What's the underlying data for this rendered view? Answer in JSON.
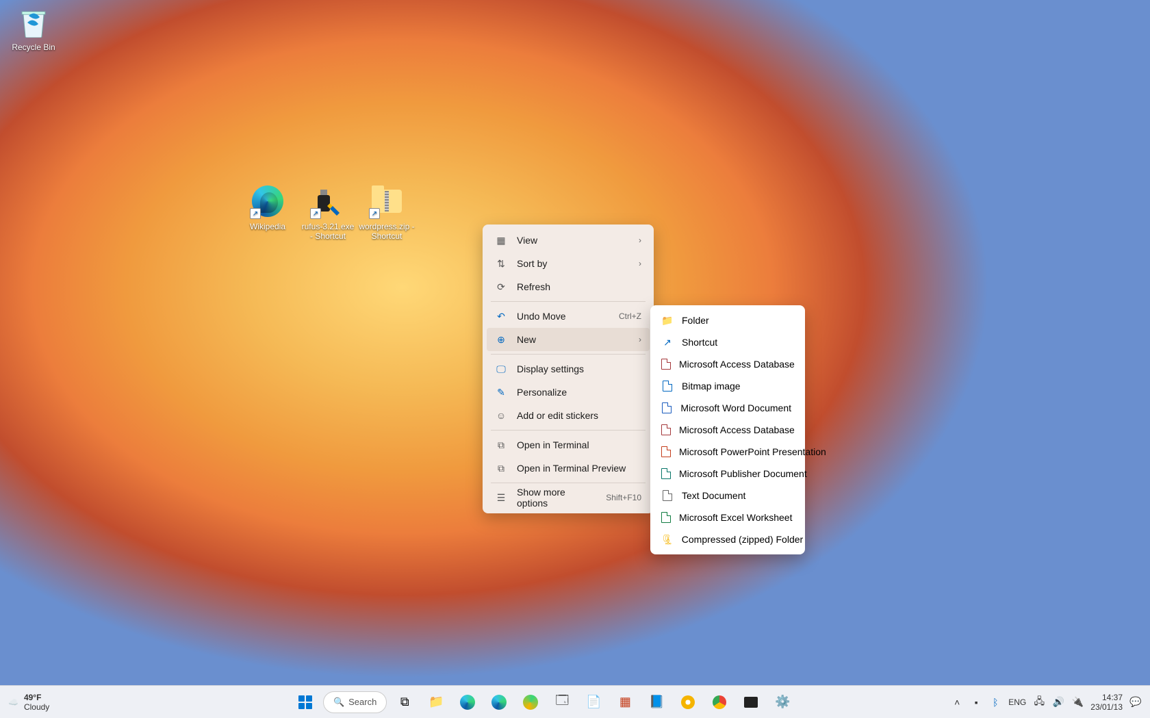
{
  "desktop_icons": {
    "recycle_bin": "Recycle Bin",
    "wikipedia": "Wikipedia",
    "rufus": "rufus-3.21.exe - Shortcut",
    "wordpress": "wordpress.zip - Shortcut"
  },
  "context_menu": {
    "view": "View",
    "sort_by": "Sort by",
    "refresh": "Refresh",
    "undo_move": "Undo Move",
    "undo_shortcut": "Ctrl+Z",
    "new": "New",
    "display_settings": "Display settings",
    "personalize": "Personalize",
    "stickers": "Add or edit stickers",
    "open_terminal": "Open in Terminal",
    "open_terminal_preview": "Open in Terminal Preview",
    "show_more": "Show more options",
    "show_more_shortcut": "Shift+F10"
  },
  "new_submenu": {
    "folder": "Folder",
    "shortcut": "Shortcut",
    "access1": "Microsoft Access Database",
    "bitmap": "Bitmap image",
    "word": "Microsoft Word Document",
    "access2": "Microsoft Access Database",
    "powerpoint": "Microsoft PowerPoint Presentation",
    "publisher": "Microsoft Publisher Document",
    "text": "Text Document",
    "excel": "Microsoft Excel Worksheet",
    "zip": "Compressed (zipped) Folder"
  },
  "taskbar": {
    "weather_temp": "49°F",
    "weather_cond": "Cloudy",
    "search": "Search",
    "lang": "ENG",
    "time": "14:37",
    "date": "23/01/13"
  }
}
